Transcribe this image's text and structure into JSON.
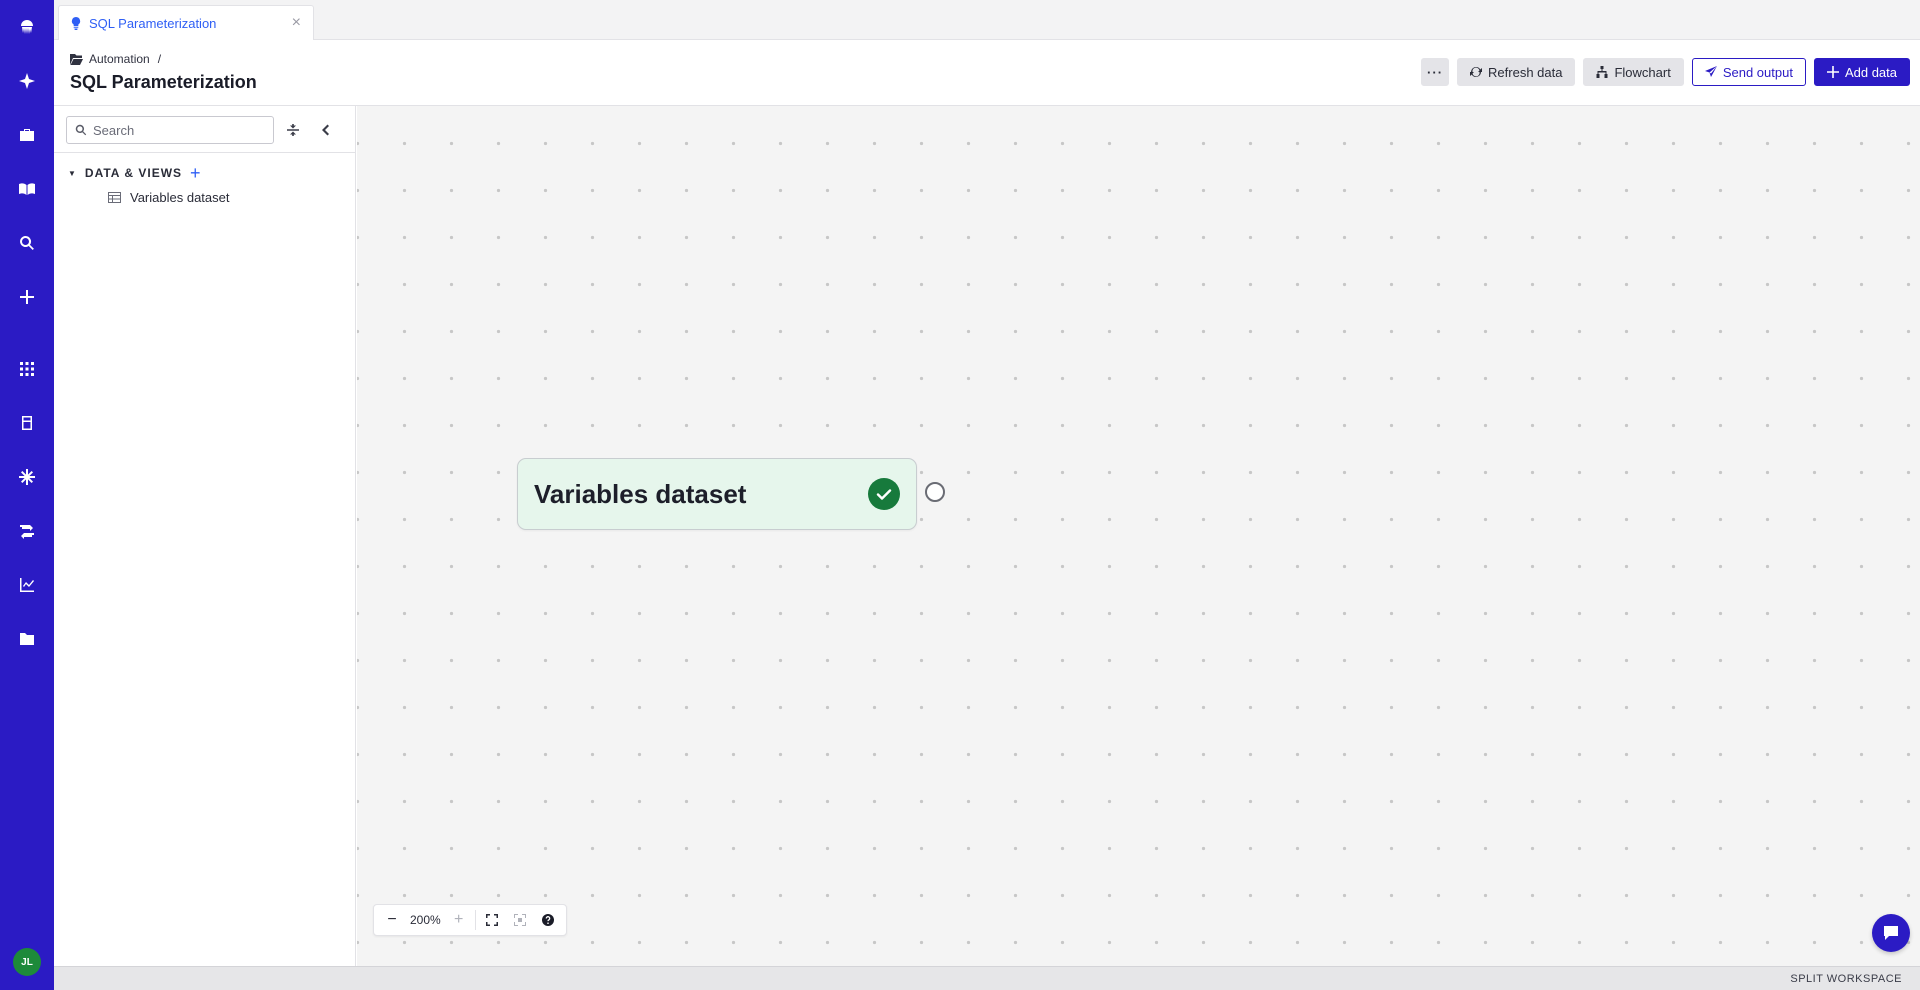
{
  "rail": {
    "items": [
      "jellyfish-logo-icon",
      "sparkle-icon",
      "briefcase-icon",
      "book-icon",
      "search-icon",
      "plus-icon",
      "apps-grid-icon",
      "database-icon",
      "snowflake-icon",
      "workflow-icon",
      "chart-icon",
      "folder-icon"
    ],
    "avatar": "JL"
  },
  "tab": {
    "label": "SQL Parameterization",
    "close": "×"
  },
  "header": {
    "breadcrumb": "Automation",
    "breadcrumb_sep": "/",
    "title": "SQL Parameterization",
    "more_label": "···",
    "refresh_label": "Refresh data",
    "flowchart_label": "Flowchart",
    "send_label": "Send output",
    "add_label": "Add data"
  },
  "panel": {
    "search_placeholder": "Search",
    "section_title": "DATA & VIEWS",
    "items": [
      {
        "label": "Variables dataset"
      }
    ]
  },
  "canvas": {
    "node_title": "Variables dataset",
    "node_status": "success",
    "zoom_level": "200%"
  },
  "footer": {
    "label": "SPLIT WORKSPACE"
  },
  "colors": {
    "brand": "#2b1bc4",
    "success": "#177a3c",
    "link": "#2f5ff5"
  }
}
